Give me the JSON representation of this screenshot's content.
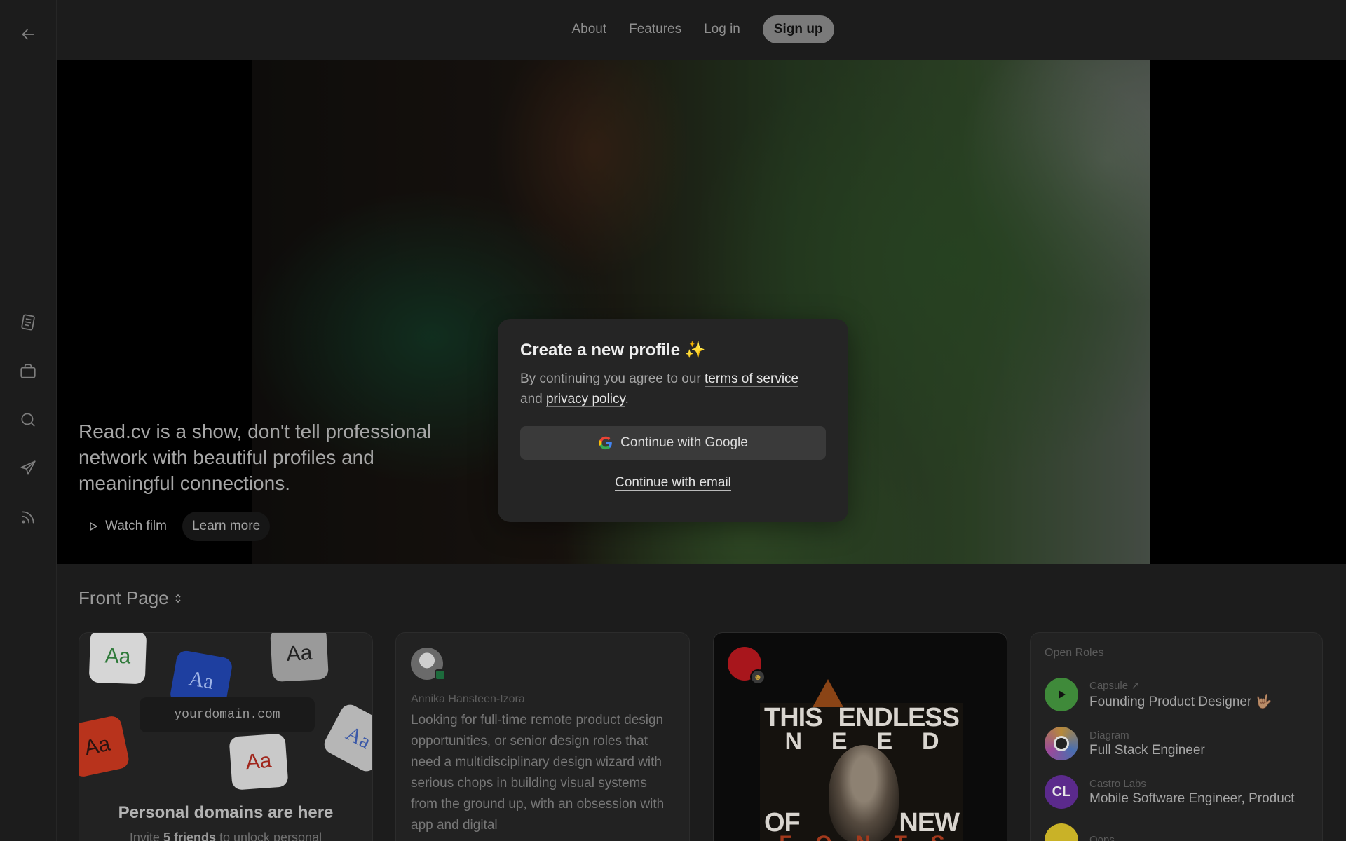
{
  "nav": {
    "about": "About",
    "features": "Features",
    "login": "Log in",
    "signup": "Sign up"
  },
  "sidebar": {
    "icons": [
      "back-arrow-icon",
      "notes-icon",
      "briefcase-icon",
      "search-icon",
      "send-icon",
      "rss-icon"
    ]
  },
  "hero": {
    "tagline": "Read.cv is a show, don't tell professional network with beautiful profiles and meaningful connections.",
    "watch_film": "Watch film",
    "learn_more": "Learn more"
  },
  "modal": {
    "title": "Create a new profile ✨",
    "sub_prefix": "By continuing you agree to our ",
    "terms": "terms of service",
    "sub_and": " and ",
    "privacy": "privacy policy",
    "sub_end": ".",
    "google": "Continue with Google",
    "email": "Continue with email"
  },
  "front_page": {
    "title": "Front Page"
  },
  "cards": {
    "domains": {
      "tile_label": "Aa",
      "domain": "yourdomain.com",
      "title": "Personal domains are here",
      "sub_prefix": "Invite ",
      "sub_bold": "5 friends",
      "sub_suffix": " to unlock personal"
    },
    "post": {
      "author": "Annika Hansteen-Izora",
      "body": "Looking for full-time remote product design opportunities, or senior design roles that need a multidisciplinary design wizard with serious chops in building visual systems from the ground up, with an obsession with app and digital"
    },
    "poster": {
      "line1": [
        "THIS",
        "ENDLESS"
      ],
      "line2": [
        "N",
        "E",
        "E",
        "D"
      ],
      "line3": [
        "OF",
        "NEW"
      ],
      "line4": [
        "F",
        "O",
        "N",
        "T",
        "S"
      ]
    },
    "roles": {
      "title": "Open Roles",
      "items": [
        {
          "company": "Capsule ↗",
          "title": "Founding Product Designer 🤟🏽",
          "logo_color": "#3f8a3a",
          "logo_text": ""
        },
        {
          "company": "Diagram",
          "title": "Full Stack Engineer",
          "logo_color": "#555555",
          "logo_text": ""
        },
        {
          "company": "Castro Labs",
          "title": "Mobile Software Engineer, Product",
          "logo_color": "#5b2a8c",
          "logo_text": "CL"
        },
        {
          "company": "Oops",
          "title": "",
          "logo_color": "#c9b227",
          "logo_text": ""
        }
      ]
    }
  },
  "colors": {
    "background": "#1c1c1c",
    "card": "#222222",
    "modal": "#252525",
    "signup_bg": "#7a7a7a"
  }
}
